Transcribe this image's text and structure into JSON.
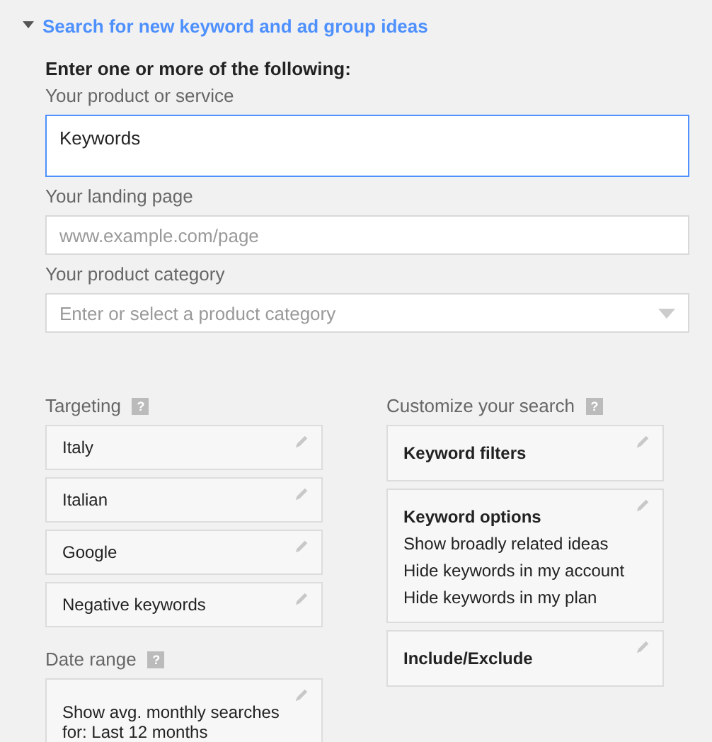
{
  "section": {
    "title": "Search for new keyword and ad group ideas",
    "expanded": true
  },
  "intro": "Enter one or more of the following:",
  "fields": [
    {
      "kind": "textarea",
      "label": "Your product or service",
      "value": "Keywords",
      "focused": true
    },
    {
      "kind": "text",
      "label": "Your landing page",
      "placeholder": "www.example.com/page",
      "focused": false
    },
    {
      "kind": "select",
      "label": "Your product category",
      "placeholder": "Enter or select a product category",
      "focused": false
    }
  ],
  "targeting": {
    "title": "Targeting",
    "help": "?",
    "items": [
      "Italy",
      "Italian",
      "Google",
      "Negative keywords"
    ]
  },
  "date_range": {
    "title": "Date range",
    "help": "?",
    "lines": [
      "Show avg. monthly searches",
      "for: Last 12 months"
    ]
  },
  "customize": {
    "title": "Customize your search",
    "help": "?",
    "cards": [
      {
        "title": "Keyword filters"
      },
      {
        "title": "Keyword options",
        "lines": [
          "Show broadly related ideas",
          "Hide keywords in my account",
          "Hide keywords in my plan"
        ]
      },
      {
        "title": "Include/Exclude"
      }
    ]
  }
}
